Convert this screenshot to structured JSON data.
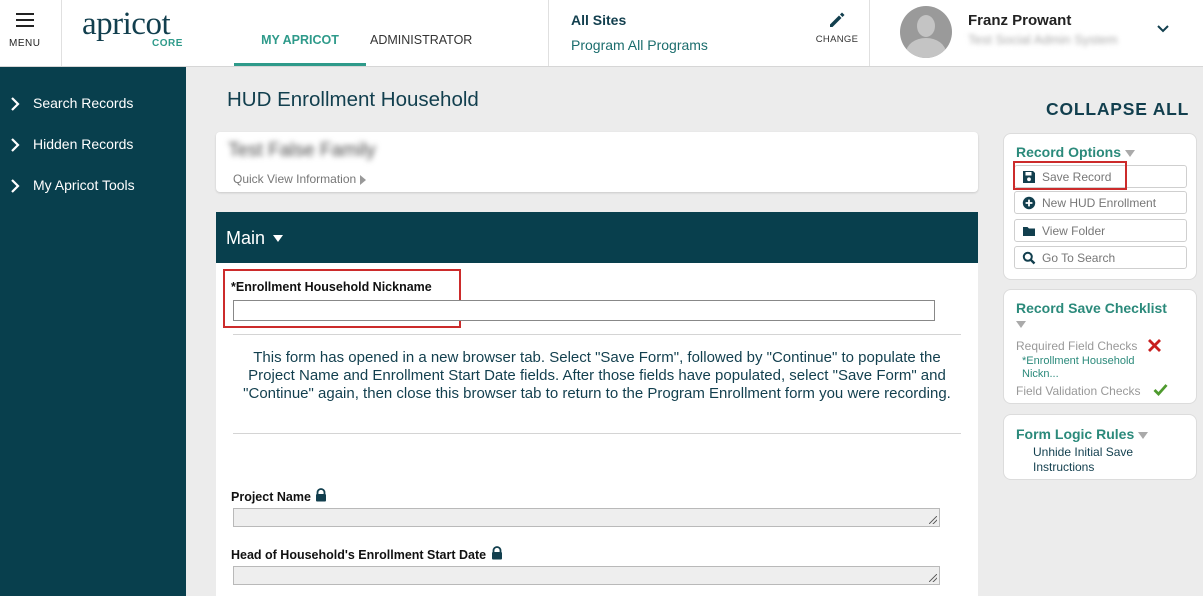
{
  "header": {
    "menu_label": "MENU",
    "logo_word": "apricot",
    "logo_sub": "CORE",
    "tabs": [
      {
        "label": "MY APRICOT",
        "active": true
      },
      {
        "label": "ADMINISTRATOR",
        "active": false
      }
    ],
    "site": {
      "title": "All Sites",
      "program": "Program All Programs",
      "change_label": "CHANGE"
    },
    "user": {
      "name": "Franz Prowant",
      "subtitle": "Test Social Admin System"
    }
  },
  "sidebar": {
    "items": [
      {
        "label": "Search Records"
      },
      {
        "label": "Hidden Records"
      },
      {
        "label": "My Apricot Tools"
      }
    ]
  },
  "main": {
    "page_title": "HUD Enrollment Household",
    "quick_view": {
      "name": "Test False Family",
      "link": "Quick View Information"
    },
    "section": {
      "title": "Main"
    },
    "fields": {
      "nickname_label": "*Enrollment Household Nickname",
      "nickname_value": "",
      "project_label": "Project Name",
      "start_date_label": "Head of Household's Enrollment Start Date"
    },
    "instructions": "This form has opened in a new browser tab.  Select \"Save Form\", followed by \"Continue\" to populate the Project Name and Enrollment Start Date fields.  After those fields have populated, select \"Save Form\" and \"Continue\" again, then close this browser tab to return to the Program Enrollment form you were recording."
  },
  "right_panel": {
    "collapse_all": "COLLAPSE ALL",
    "record_options": {
      "title": "Record Options",
      "buttons": [
        {
          "label": "Save Record",
          "icon": "floppy-disk-icon"
        },
        {
          "label": "New HUD Enrollment",
          "icon": "plus-circle-icon"
        },
        {
          "label": "View Folder",
          "icon": "folder-icon"
        },
        {
          "label": "Go To Search",
          "icon": "search-icon"
        }
      ]
    },
    "checklist": {
      "title": "Record Save Checklist",
      "required_label": "Required Field Checks",
      "required_item": "*Enrollment Household Nickn...",
      "validation_label": "Field Validation Checks"
    },
    "form_logic": {
      "title": "Form Logic Rules",
      "rule": "Unhide Initial Save Instructions"
    }
  },
  "colors": {
    "navy": "#083f4d",
    "teal": "#2e9a8a",
    "highlight_red": "#cc2b2b",
    "error_red": "#c81f1f",
    "ok_green": "#4e9a2e"
  }
}
